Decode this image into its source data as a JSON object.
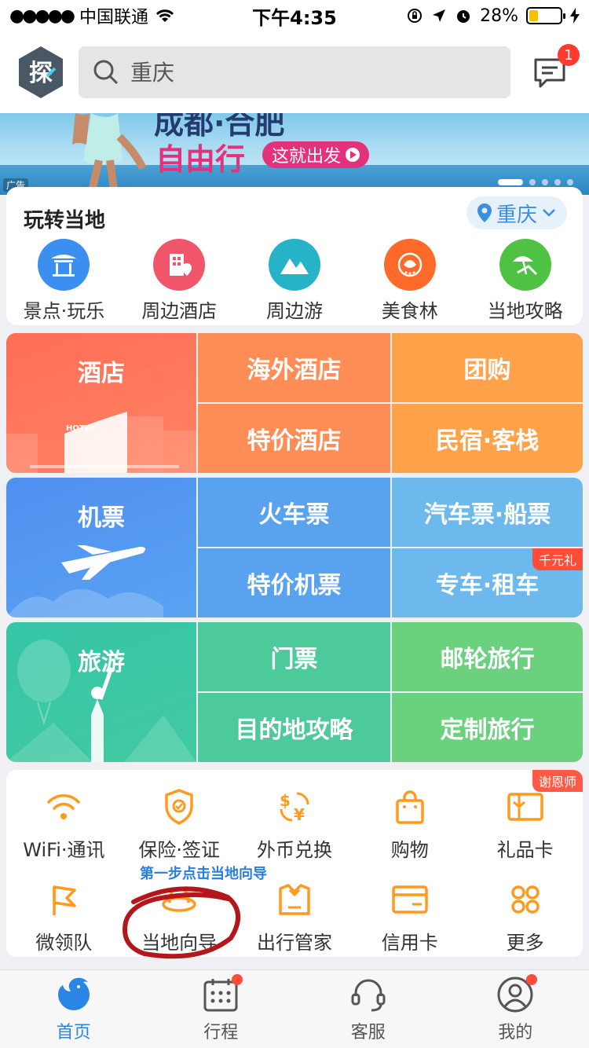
{
  "status_bar": {
    "carrier": "中国联通",
    "time": "下午4:35",
    "battery_percent": "28%",
    "battery_level": 0.28
  },
  "header": {
    "search_placeholder": "重庆",
    "message_badge": "1",
    "logo_text": "探"
  },
  "banner": {
    "title_top": "成都·合肥",
    "title_main": "自由行",
    "cta": "这就出发",
    "ad_label": "广告"
  },
  "local": {
    "title": "玩转当地",
    "city": "重庆",
    "items": [
      {
        "label": "景点·玩乐",
        "icon": "pavilion-icon",
        "color": "#3a8ff0"
      },
      {
        "label": "周边酒店",
        "icon": "hotel-building-icon",
        "color": "#f0566a"
      },
      {
        "label": "周边游",
        "icon": "mountain-icon",
        "color": "#27b3c7"
      },
      {
        "label": "美食林",
        "icon": "food-emblem-icon",
        "color": "#ff6a2a"
      },
      {
        "label": "当地攻略",
        "icon": "beach-chair-icon",
        "color": "#4fc244"
      }
    ]
  },
  "grid": {
    "hotel": {
      "main": "酒店",
      "overseas": "海外酒店",
      "group": "团购",
      "special": "特价酒店",
      "homestay": "民宿·客栈",
      "sign": "HOTEL"
    },
    "transport": {
      "main": "机票",
      "train": "火车票",
      "bus_ship": "汽车票·船票",
      "cheap_flight": "特价机票",
      "car_rent": "专车·租车",
      "car_tag": "千元礼"
    },
    "travel": {
      "main": "旅游",
      "tickets": "门票",
      "cruise": "邮轮旅行",
      "guide": "目的地攻略",
      "custom": "定制旅行"
    }
  },
  "services": {
    "corner_tag": "谢恩师",
    "hint": "第一步点击当地向导",
    "row1": [
      {
        "label": "WiFi·通讯",
        "icon": "wifi-icon"
      },
      {
        "label": "保险·签证",
        "icon": "shield-icon"
      },
      {
        "label": "外币兑换",
        "icon": "currency-exchange-icon"
      },
      {
        "label": "购物",
        "icon": "shopping-bag-icon"
      },
      {
        "label": "礼品卡",
        "icon": "gift-card-icon"
      }
    ],
    "row2": [
      {
        "label": "微领队",
        "icon": "flag-icon"
      },
      {
        "label": "当地向导",
        "icon": "guide-hat-icon"
      },
      {
        "label": "出行管家",
        "icon": "butler-icon"
      },
      {
        "label": "信用卡",
        "icon": "credit-card-icon"
      },
      {
        "label": "更多",
        "icon": "more-grid-icon"
      }
    ],
    "accent": "#ff9a1f"
  },
  "tabbar": {
    "items": [
      {
        "label": "首页",
        "icon": "home-dolphin-icon",
        "active": true
      },
      {
        "label": "行程",
        "icon": "calendar-icon",
        "dot": true
      },
      {
        "label": "客服",
        "icon": "headset-icon"
      },
      {
        "label": "我的",
        "icon": "profile-icon",
        "dot": true
      }
    ]
  }
}
